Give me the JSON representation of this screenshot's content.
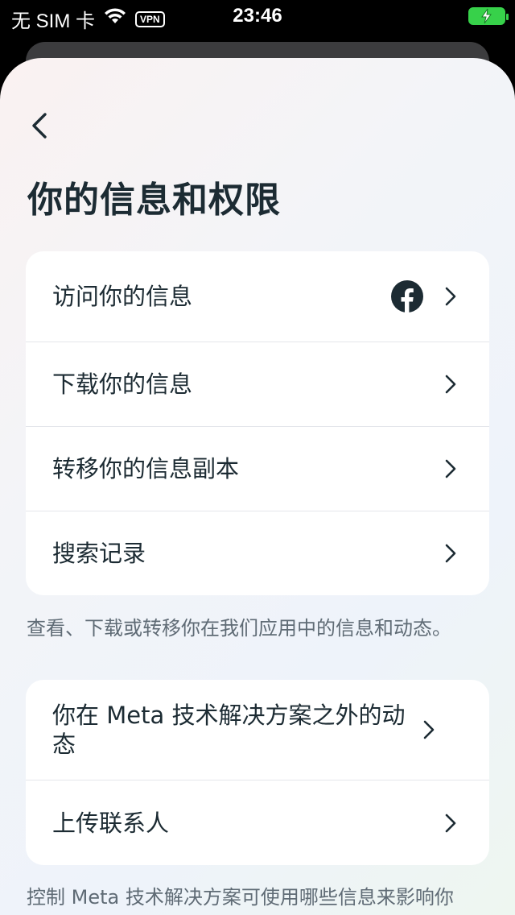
{
  "status_bar": {
    "carrier": "无 SIM 卡",
    "vpn": "VPN",
    "time": "23:46"
  },
  "page": {
    "title": "你的信息和权限"
  },
  "section1": {
    "items": [
      {
        "label": "访问你的信息",
        "icon": "facebook-icon"
      },
      {
        "label": "下载你的信息"
      },
      {
        "label": "转移你的信息副本"
      },
      {
        "label": "搜索记录"
      }
    ],
    "caption": "查看、下载或转移你在我们应用中的信息和动态。"
  },
  "section2": {
    "items": [
      {
        "label": "你在 Meta 技术解决方案之外的动态"
      },
      {
        "label": "上传联系人"
      }
    ],
    "caption": "控制 Meta 技术解决方案可使用哪些信息来影响你"
  },
  "colors": {
    "text": "#1c2b33",
    "caption": "#5f6b75",
    "battery": "#37d14a"
  }
}
